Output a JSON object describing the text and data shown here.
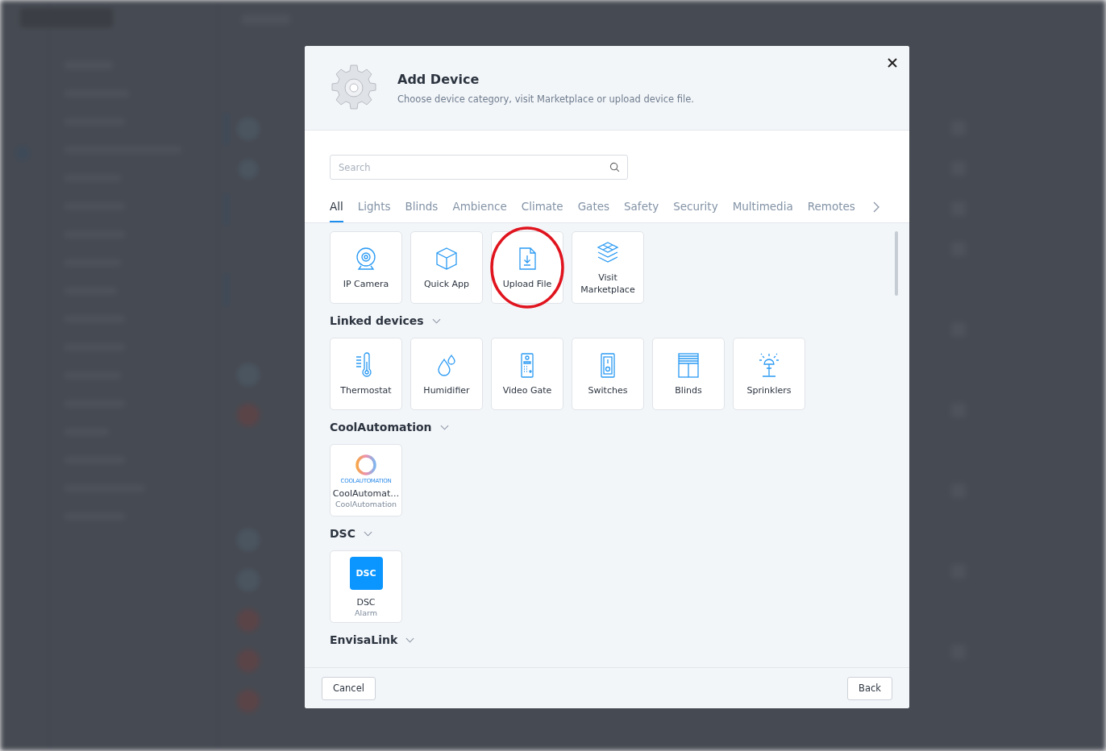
{
  "dialog": {
    "title": "Add Device",
    "subtitle": "Choose device category, visit Marketplace or upload device file.",
    "search": {
      "placeholder": "Search"
    },
    "tabs": [
      {
        "label": "All",
        "selected": true
      },
      {
        "label": "Lights",
        "selected": false
      },
      {
        "label": "Blinds",
        "selected": false
      },
      {
        "label": "Ambience",
        "selected": false
      },
      {
        "label": "Climate",
        "selected": false
      },
      {
        "label": "Gates",
        "selected": false
      },
      {
        "label": "Safety",
        "selected": false
      },
      {
        "label": "Security",
        "selected": false
      },
      {
        "label": "Multimedia",
        "selected": false
      },
      {
        "label": "Remotes",
        "selected": false
      }
    ],
    "tiles": [
      {
        "label": "IP Camera",
        "kind": "camera",
        "highlighted": false
      },
      {
        "label": "Quick App",
        "kind": "cube",
        "highlighted": false
      },
      {
        "label": "Upload File",
        "kind": "file",
        "highlighted": true
      },
      {
        "label": "Visit Marketplace",
        "kind": "layers",
        "highlighted": false
      }
    ],
    "sections": [
      {
        "title": "Linked devices",
        "items": [
          {
            "label": "Thermostat",
            "kind": "thermometer"
          },
          {
            "label": "Humidifier",
            "kind": "drops"
          },
          {
            "label": "Video Gate",
            "kind": "intercom"
          },
          {
            "label": "Switches",
            "kind": "switch"
          },
          {
            "label": "Blinds",
            "kind": "blinds"
          },
          {
            "label": "Sprinklers",
            "kind": "sprinkler"
          }
        ]
      },
      {
        "title": "CoolAutomation",
        "items": [
          {
            "label": "CoolAutomat…",
            "sublabel": "CoolAutomation",
            "kind": "ring",
            "logo_text": "COOLAUTOMATION"
          }
        ]
      },
      {
        "title": "DSC",
        "items": [
          {
            "label": "DSC",
            "sublabel": "Alarm",
            "kind": "badge",
            "logo_text": "DSC"
          }
        ]
      },
      {
        "title": "EnvisaLink"
      }
    ],
    "buttons": [
      {
        "label": "Cancel"
      },
      {
        "label": "Back"
      }
    ]
  }
}
